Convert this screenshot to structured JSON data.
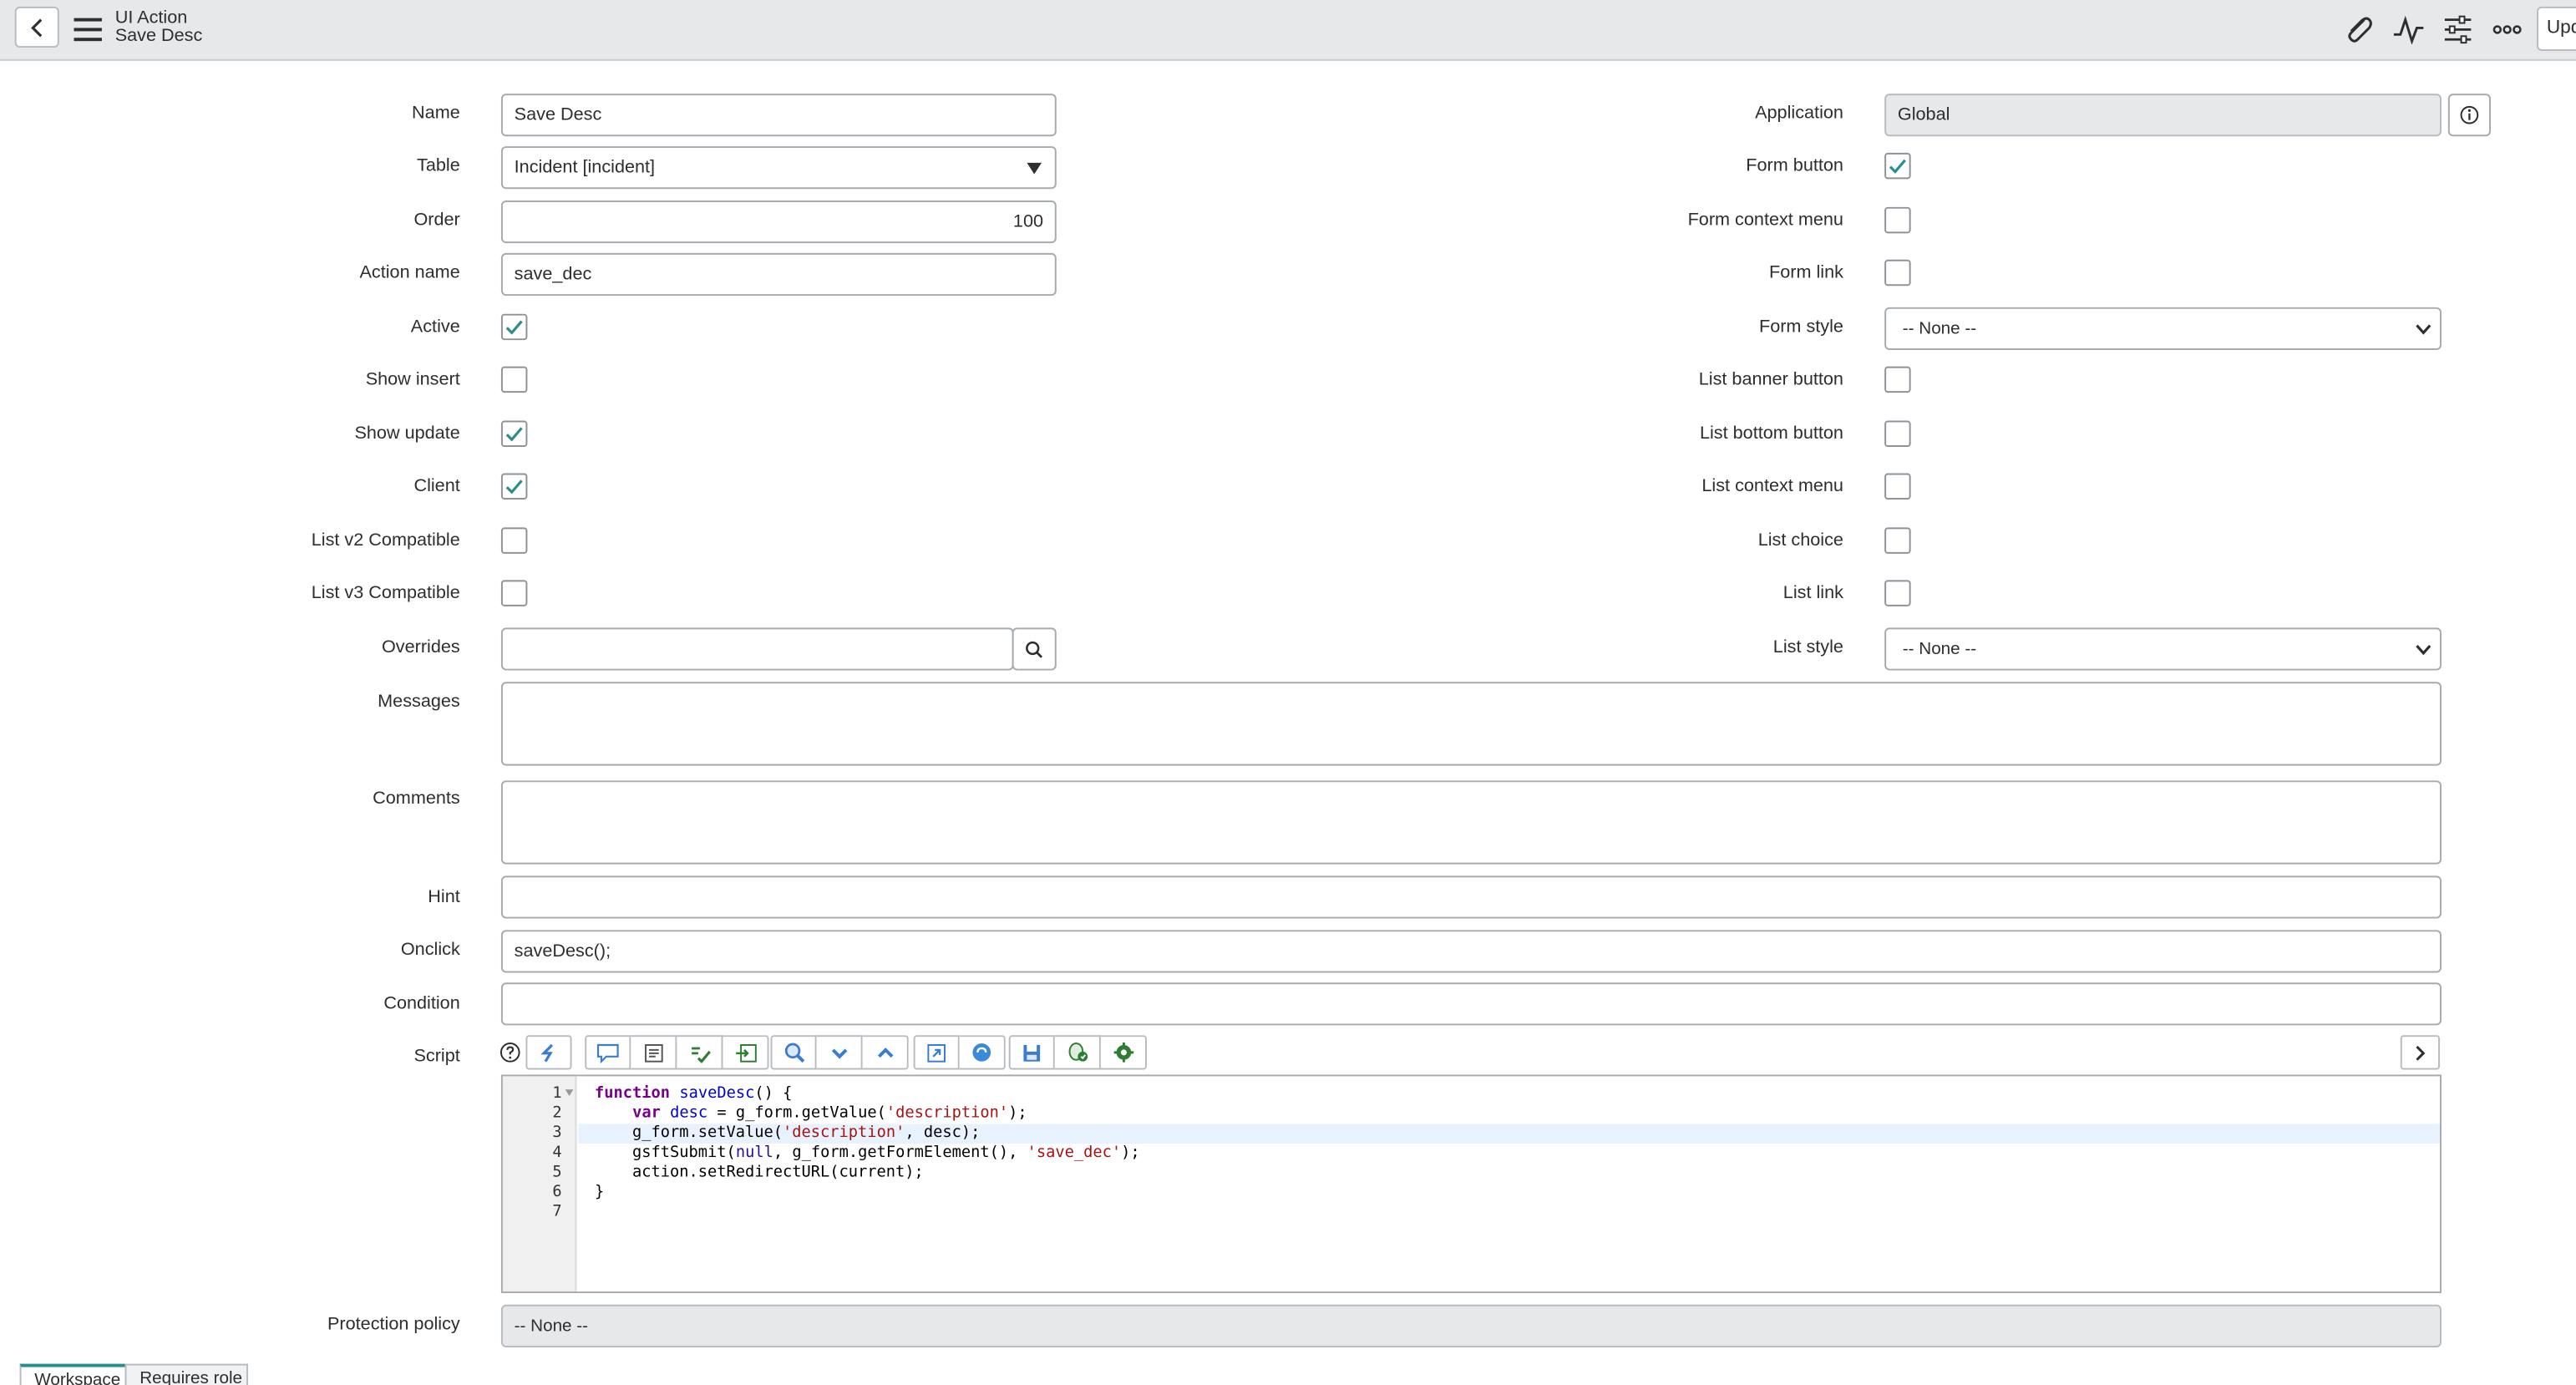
{
  "header": {
    "record_type": "UI Action",
    "record_name": "Save Desc",
    "update_button": "Update",
    "icons": [
      "back-icon",
      "menu-icon",
      "paperclip-icon",
      "activity-icon",
      "settings-sliders-icon",
      "more-icon"
    ]
  },
  "left_fields": {
    "name": {
      "label": "Name",
      "value": "Save Desc"
    },
    "table": {
      "label": "Table",
      "value": "Incident [incident]"
    },
    "order": {
      "label": "Order",
      "value": "100"
    },
    "action_name": {
      "label": "Action name",
      "value": "save_dec"
    },
    "active": {
      "label": "Active",
      "checked": true
    },
    "show_insert": {
      "label": "Show insert",
      "checked": false
    },
    "show_update": {
      "label": "Show update",
      "checked": true
    },
    "client": {
      "label": "Client",
      "checked": true
    },
    "list_v2": {
      "label": "List v2 Compatible",
      "checked": false
    },
    "list_v3": {
      "label": "List v3 Compatible",
      "checked": false
    },
    "overrides": {
      "label": "Overrides",
      "value": ""
    }
  },
  "right_fields": {
    "application": {
      "label": "Application",
      "value": "Global"
    },
    "form_button": {
      "label": "Form button",
      "checked": true
    },
    "form_context_menu": {
      "label": "Form context menu",
      "checked": false
    },
    "form_link": {
      "label": "Form link",
      "checked": false
    },
    "form_style": {
      "label": "Form style",
      "value": "-- None --"
    },
    "list_banner_button": {
      "label": "List banner button",
      "checked": false
    },
    "list_bottom_button": {
      "label": "List bottom button",
      "checked": false
    },
    "list_context_menu": {
      "label": "List context menu",
      "checked": false
    },
    "list_choice": {
      "label": "List choice",
      "checked": false
    },
    "list_link": {
      "label": "List link",
      "checked": false
    },
    "list_style": {
      "label": "List style",
      "value": "-- None --"
    }
  },
  "wide_fields": {
    "messages": {
      "label": "Messages",
      "value": ""
    },
    "comments": {
      "label": "Comments",
      "value": ""
    },
    "hint": {
      "label": "Hint",
      "value": ""
    },
    "onclick": {
      "label": "Onclick",
      "value": "saveDesc();"
    },
    "condition": {
      "label": "Condition",
      "value": ""
    },
    "script": {
      "label": "Script"
    },
    "protection_policy": {
      "label": "Protection policy",
      "value": "-- None --"
    }
  },
  "script_lines": [
    "function saveDesc() {",
    "    var desc = g_form.getValue('description');",
    "    g_form.setValue('description', desc);",
    "    gsftSubmit(null, g_form.getFormElement(), 'save_dec');",
    "    action.setRedirectURL(current);",
    "}",
    ""
  ],
  "line_numbers": [
    "1",
    "2",
    "3",
    "4",
    "5",
    "6",
    "7"
  ],
  "bottom_tabs": [
    "Workspace",
    "Requires role"
  ],
  "colors": {
    "header_bg": "#e6e8ea",
    "check_teal": "#278d8d",
    "accent": "#278d8d"
  }
}
